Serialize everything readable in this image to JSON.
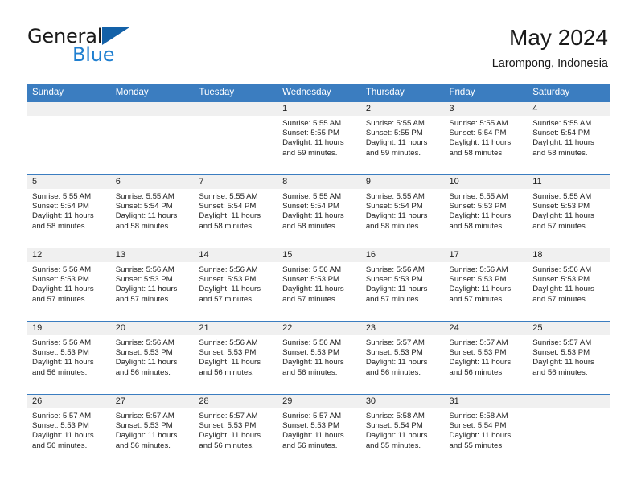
{
  "brand": {
    "name_part1": "General",
    "name_part2": "Blue",
    "logo_icon": "triangle-logo-icon",
    "accent_color": "#1f7fd0",
    "triangle_color": "#1361a8"
  },
  "header": {
    "month_title": "May 2024",
    "location": "Larompong, Indonesia"
  },
  "calendar": {
    "header_color": "#3b7dc0",
    "daynum_bar_color": "#f0f0f0",
    "weekday_headers": [
      "Sunday",
      "Monday",
      "Tuesday",
      "Wednesday",
      "Thursday",
      "Friday",
      "Saturday"
    ],
    "weeks": [
      [
        {
          "day": "",
          "empty": true,
          "sunrise": "",
          "sunset": "",
          "daylight_line1": "",
          "daylight_line2": ""
        },
        {
          "day": "",
          "empty": true,
          "sunrise": "",
          "sunset": "",
          "daylight_line1": "",
          "daylight_line2": ""
        },
        {
          "day": "",
          "empty": true,
          "sunrise": "",
          "sunset": "",
          "daylight_line1": "",
          "daylight_line2": ""
        },
        {
          "day": "1",
          "empty": false,
          "sunrise": "Sunrise: 5:55 AM",
          "sunset": "Sunset: 5:55 PM",
          "daylight_line1": "Daylight: 11 hours",
          "daylight_line2": "and 59 minutes."
        },
        {
          "day": "2",
          "empty": false,
          "sunrise": "Sunrise: 5:55 AM",
          "sunset": "Sunset: 5:55 PM",
          "daylight_line1": "Daylight: 11 hours",
          "daylight_line2": "and 59 minutes."
        },
        {
          "day": "3",
          "empty": false,
          "sunrise": "Sunrise: 5:55 AM",
          "sunset": "Sunset: 5:54 PM",
          "daylight_line1": "Daylight: 11 hours",
          "daylight_line2": "and 58 minutes."
        },
        {
          "day": "4",
          "empty": false,
          "sunrise": "Sunrise: 5:55 AM",
          "sunset": "Sunset: 5:54 PM",
          "daylight_line1": "Daylight: 11 hours",
          "daylight_line2": "and 58 minutes."
        }
      ],
      [
        {
          "day": "5",
          "empty": false,
          "sunrise": "Sunrise: 5:55 AM",
          "sunset": "Sunset: 5:54 PM",
          "daylight_line1": "Daylight: 11 hours",
          "daylight_line2": "and 58 minutes."
        },
        {
          "day": "6",
          "empty": false,
          "sunrise": "Sunrise: 5:55 AM",
          "sunset": "Sunset: 5:54 PM",
          "daylight_line1": "Daylight: 11 hours",
          "daylight_line2": "and 58 minutes."
        },
        {
          "day": "7",
          "empty": false,
          "sunrise": "Sunrise: 5:55 AM",
          "sunset": "Sunset: 5:54 PM",
          "daylight_line1": "Daylight: 11 hours",
          "daylight_line2": "and 58 minutes."
        },
        {
          "day": "8",
          "empty": false,
          "sunrise": "Sunrise: 5:55 AM",
          "sunset": "Sunset: 5:54 PM",
          "daylight_line1": "Daylight: 11 hours",
          "daylight_line2": "and 58 minutes."
        },
        {
          "day": "9",
          "empty": false,
          "sunrise": "Sunrise: 5:55 AM",
          "sunset": "Sunset: 5:54 PM",
          "daylight_line1": "Daylight: 11 hours",
          "daylight_line2": "and 58 minutes."
        },
        {
          "day": "10",
          "empty": false,
          "sunrise": "Sunrise: 5:55 AM",
          "sunset": "Sunset: 5:53 PM",
          "daylight_line1": "Daylight: 11 hours",
          "daylight_line2": "and 58 minutes."
        },
        {
          "day": "11",
          "empty": false,
          "sunrise": "Sunrise: 5:55 AM",
          "sunset": "Sunset: 5:53 PM",
          "daylight_line1": "Daylight: 11 hours",
          "daylight_line2": "and 57 minutes."
        }
      ],
      [
        {
          "day": "12",
          "empty": false,
          "sunrise": "Sunrise: 5:56 AM",
          "sunset": "Sunset: 5:53 PM",
          "daylight_line1": "Daylight: 11 hours",
          "daylight_line2": "and 57 minutes."
        },
        {
          "day": "13",
          "empty": false,
          "sunrise": "Sunrise: 5:56 AM",
          "sunset": "Sunset: 5:53 PM",
          "daylight_line1": "Daylight: 11 hours",
          "daylight_line2": "and 57 minutes."
        },
        {
          "day": "14",
          "empty": false,
          "sunrise": "Sunrise: 5:56 AM",
          "sunset": "Sunset: 5:53 PM",
          "daylight_line1": "Daylight: 11 hours",
          "daylight_line2": "and 57 minutes."
        },
        {
          "day": "15",
          "empty": false,
          "sunrise": "Sunrise: 5:56 AM",
          "sunset": "Sunset: 5:53 PM",
          "daylight_line1": "Daylight: 11 hours",
          "daylight_line2": "and 57 minutes."
        },
        {
          "day": "16",
          "empty": false,
          "sunrise": "Sunrise: 5:56 AM",
          "sunset": "Sunset: 5:53 PM",
          "daylight_line1": "Daylight: 11 hours",
          "daylight_line2": "and 57 minutes."
        },
        {
          "day": "17",
          "empty": false,
          "sunrise": "Sunrise: 5:56 AM",
          "sunset": "Sunset: 5:53 PM",
          "daylight_line1": "Daylight: 11 hours",
          "daylight_line2": "and 57 minutes."
        },
        {
          "day": "18",
          "empty": false,
          "sunrise": "Sunrise: 5:56 AM",
          "sunset": "Sunset: 5:53 PM",
          "daylight_line1": "Daylight: 11 hours",
          "daylight_line2": "and 57 minutes."
        }
      ],
      [
        {
          "day": "19",
          "empty": false,
          "sunrise": "Sunrise: 5:56 AM",
          "sunset": "Sunset: 5:53 PM",
          "daylight_line1": "Daylight: 11 hours",
          "daylight_line2": "and 56 minutes."
        },
        {
          "day": "20",
          "empty": false,
          "sunrise": "Sunrise: 5:56 AM",
          "sunset": "Sunset: 5:53 PM",
          "daylight_line1": "Daylight: 11 hours",
          "daylight_line2": "and 56 minutes."
        },
        {
          "day": "21",
          "empty": false,
          "sunrise": "Sunrise: 5:56 AM",
          "sunset": "Sunset: 5:53 PM",
          "daylight_line1": "Daylight: 11 hours",
          "daylight_line2": "and 56 minutes."
        },
        {
          "day": "22",
          "empty": false,
          "sunrise": "Sunrise: 5:56 AM",
          "sunset": "Sunset: 5:53 PM",
          "daylight_line1": "Daylight: 11 hours",
          "daylight_line2": "and 56 minutes."
        },
        {
          "day": "23",
          "empty": false,
          "sunrise": "Sunrise: 5:57 AM",
          "sunset": "Sunset: 5:53 PM",
          "daylight_line1": "Daylight: 11 hours",
          "daylight_line2": "and 56 minutes."
        },
        {
          "day": "24",
          "empty": false,
          "sunrise": "Sunrise: 5:57 AM",
          "sunset": "Sunset: 5:53 PM",
          "daylight_line1": "Daylight: 11 hours",
          "daylight_line2": "and 56 minutes."
        },
        {
          "day": "25",
          "empty": false,
          "sunrise": "Sunrise: 5:57 AM",
          "sunset": "Sunset: 5:53 PM",
          "daylight_line1": "Daylight: 11 hours",
          "daylight_line2": "and 56 minutes."
        }
      ],
      [
        {
          "day": "26",
          "empty": false,
          "sunrise": "Sunrise: 5:57 AM",
          "sunset": "Sunset: 5:53 PM",
          "daylight_line1": "Daylight: 11 hours",
          "daylight_line2": "and 56 minutes."
        },
        {
          "day": "27",
          "empty": false,
          "sunrise": "Sunrise: 5:57 AM",
          "sunset": "Sunset: 5:53 PM",
          "daylight_line1": "Daylight: 11 hours",
          "daylight_line2": "and 56 minutes."
        },
        {
          "day": "28",
          "empty": false,
          "sunrise": "Sunrise: 5:57 AM",
          "sunset": "Sunset: 5:53 PM",
          "daylight_line1": "Daylight: 11 hours",
          "daylight_line2": "and 56 minutes."
        },
        {
          "day": "29",
          "empty": false,
          "sunrise": "Sunrise: 5:57 AM",
          "sunset": "Sunset: 5:53 PM",
          "daylight_line1": "Daylight: 11 hours",
          "daylight_line2": "and 56 minutes."
        },
        {
          "day": "30",
          "empty": false,
          "sunrise": "Sunrise: 5:58 AM",
          "sunset": "Sunset: 5:54 PM",
          "daylight_line1": "Daylight: 11 hours",
          "daylight_line2": "and 55 minutes."
        },
        {
          "day": "31",
          "empty": false,
          "sunrise": "Sunrise: 5:58 AM",
          "sunset": "Sunset: 5:54 PM",
          "daylight_line1": "Daylight: 11 hours",
          "daylight_line2": "and 55 minutes."
        },
        {
          "day": "",
          "empty": true,
          "sunrise": "",
          "sunset": "",
          "daylight_line1": "",
          "daylight_line2": ""
        }
      ]
    ]
  }
}
